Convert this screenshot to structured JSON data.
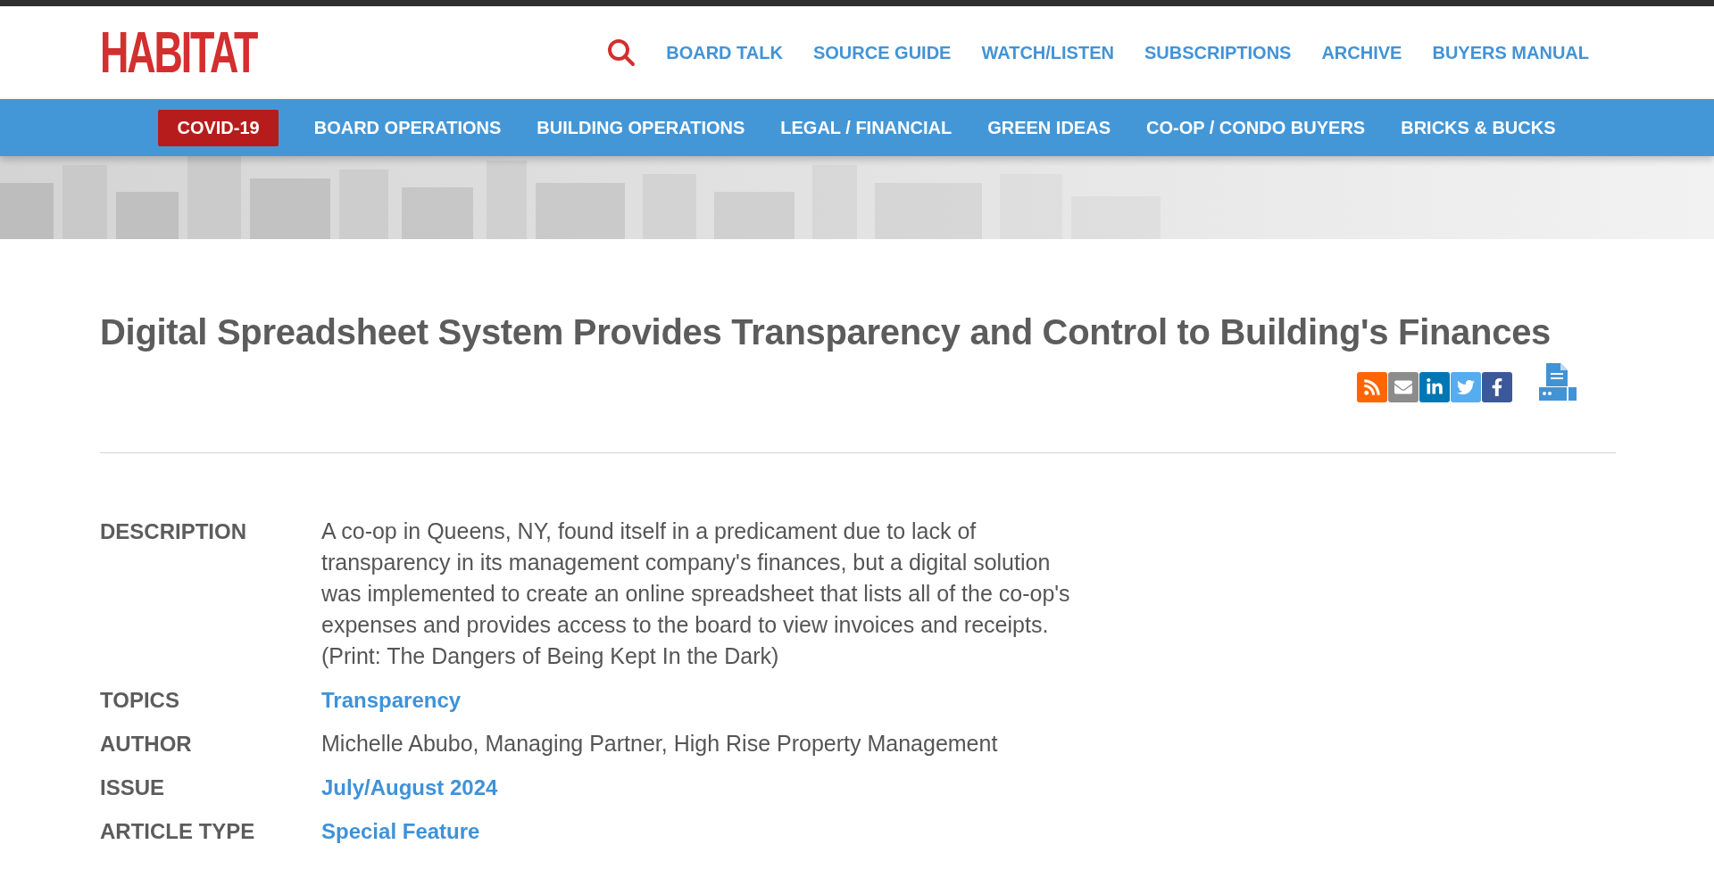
{
  "header": {
    "logo": "HABITAT",
    "nav": [
      {
        "label": "BOARD TALK"
      },
      {
        "label": "SOURCE GUIDE"
      },
      {
        "label": "WATCH/LISTEN"
      },
      {
        "label": "SUBSCRIPTIONS"
      },
      {
        "label": "ARCHIVE"
      },
      {
        "label": "BUYERS MANUAL"
      }
    ]
  },
  "category_bar": {
    "items": [
      {
        "label": "COVID-19",
        "kind": "highlight"
      },
      {
        "label": "BOARD OPERATIONS",
        "kind": "link"
      },
      {
        "label": "BUILDING OPERATIONS",
        "kind": "link"
      },
      {
        "label": "LEGAL / FINANCIAL",
        "kind": "link"
      },
      {
        "label": "GREEN IDEAS",
        "kind": "link"
      },
      {
        "label": "CO-OP / CONDO BUYERS",
        "kind": "link"
      },
      {
        "label": "BRICKS & BUCKS",
        "kind": "link"
      }
    ]
  },
  "article": {
    "title": "Digital Spreadsheet System Provides Transparency and Control to Building's Finances",
    "share": [
      {
        "kind": "rss",
        "color": "#ff6600"
      },
      {
        "kind": "email",
        "color": "#8c8c8c"
      },
      {
        "kind": "linkedin",
        "color": "#0077b5"
      },
      {
        "kind": "twitter",
        "color": "#55acee"
      },
      {
        "kind": "facebook",
        "color": "#3b5998"
      }
    ],
    "details": [
      {
        "label": "DESCRIPTION",
        "value": "A co-op in Queens, NY, found itself in a predicament due to lack of transparency in its management company's finances, but a digital solution was implemented to create an online spreadsheet that lists all of the co-op's expenses and provides access to the board to view invoices and receipts. (Print: The Dangers of Being Kept In the Dark)",
        "kind": "text"
      },
      {
        "label": "TOPICS",
        "value": "Transparency",
        "kind": "link"
      },
      {
        "label": "AUTHOR",
        "value": "Michelle Abubo, Managing Partner, High Rise Property Management",
        "kind": "text"
      },
      {
        "label": "ISSUE",
        "value": "July/August 2024",
        "kind": "link"
      },
      {
        "label": "ARTICLE TYPE",
        "value": "Special Feature",
        "kind": "link"
      }
    ]
  }
}
